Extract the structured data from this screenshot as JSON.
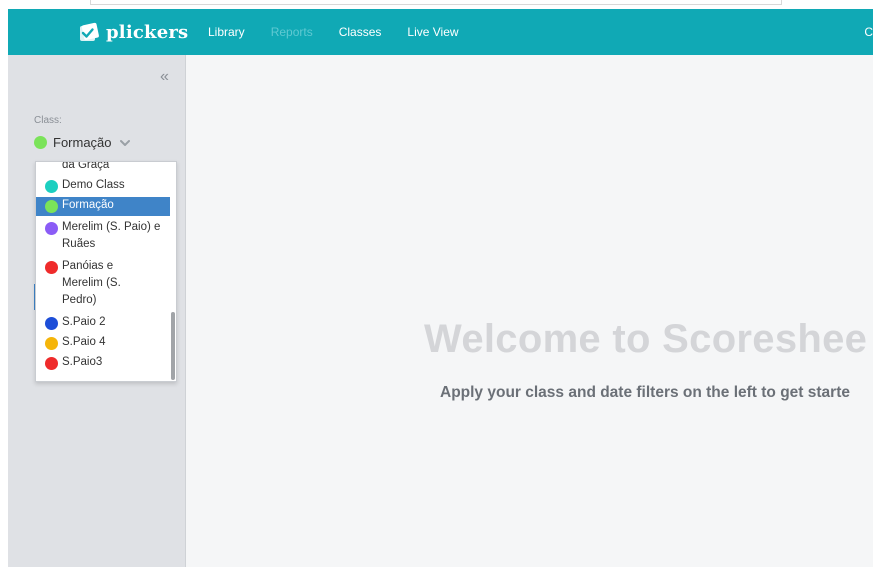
{
  "app": {
    "name": "plickers"
  },
  "nav": {
    "links": [
      {
        "label": "Library",
        "active": true
      },
      {
        "label": "Reports",
        "active": false
      },
      {
        "label": "Classes",
        "active": true
      },
      {
        "label": "Live View",
        "active": true
      }
    ],
    "right_partial": "C"
  },
  "sidebar": {
    "collapse_glyph": "«",
    "class_label": "Class:",
    "selected_class": {
      "name": "Formação",
      "color": "#7be35a"
    }
  },
  "dropdown": {
    "items": [
      {
        "label": "da Graça",
        "color": null
      },
      {
        "label": "Demo Class",
        "color": "#1ccfc0"
      },
      {
        "label": "Formação",
        "color": "#7be35a",
        "selected": true
      },
      {
        "label": "Merelim (S. Paio) e Ruães",
        "color": "#8b5cf6"
      },
      {
        "label": "Panóias e Merelim (S. Pedro)",
        "color": "#ef2b2b"
      },
      {
        "label": "S.Paio 2",
        "color": "#1d4ed8"
      },
      {
        "label": "S.Paio 4",
        "color": "#f5b50a"
      },
      {
        "label": "S.Paio3",
        "color": "#ef2b2b"
      }
    ]
  },
  "main": {
    "welcome_title": "Welcome to Scoreshee",
    "subtitle": "Apply your class and date filters on the left to get starte"
  },
  "colors": {
    "navbar": "#10a9b5",
    "sidebar": "#dfe1e5",
    "selected_row": "#3f84c8"
  }
}
